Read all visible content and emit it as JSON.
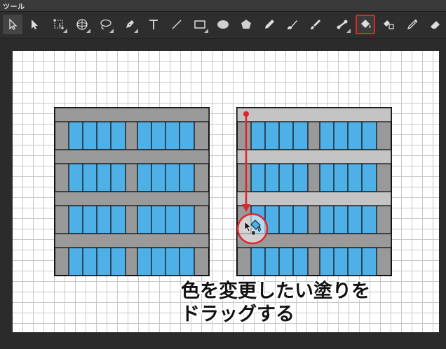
{
  "panel": {
    "title": "ツール"
  },
  "toolbar": {
    "tools": [
      {
        "name": "select-arrow-icon",
        "selected": true
      },
      {
        "name": "direct-select-icon"
      },
      {
        "name": "transform-icon"
      },
      {
        "name": "3d-rotate-icon"
      },
      {
        "name": "lasso-icon"
      },
      {
        "name": "pen-tool-icon"
      },
      {
        "name": "text-tool-icon",
        "glyph": "T"
      },
      {
        "name": "line-tool-icon"
      },
      {
        "name": "rectangle-tool-icon"
      },
      {
        "name": "ellipse-tool-icon"
      },
      {
        "name": "polygon-tool-icon"
      },
      {
        "name": "pencil-tool-icon"
      },
      {
        "name": "brush-tool-icon"
      },
      {
        "name": "paintbrush-tool-icon"
      },
      {
        "name": "bone-tool-icon"
      },
      {
        "name": "paint-bucket-tool-icon",
        "highlighted": true
      },
      {
        "name": "ink-bottle-tool-icon"
      },
      {
        "name": "eyedropper-tool-icon"
      },
      {
        "name": "eraser-tool-icon"
      }
    ]
  },
  "colors": {
    "window_blue": "#4fb0e8",
    "building_gray": "#999999",
    "band_gray": "#9a9a9a",
    "band_light_gray": "#c4c4c4",
    "highlight_red": "#e0242b"
  },
  "instruction": {
    "line1": "色を変更したい塗りを",
    "line2": "ドラッグする"
  }
}
